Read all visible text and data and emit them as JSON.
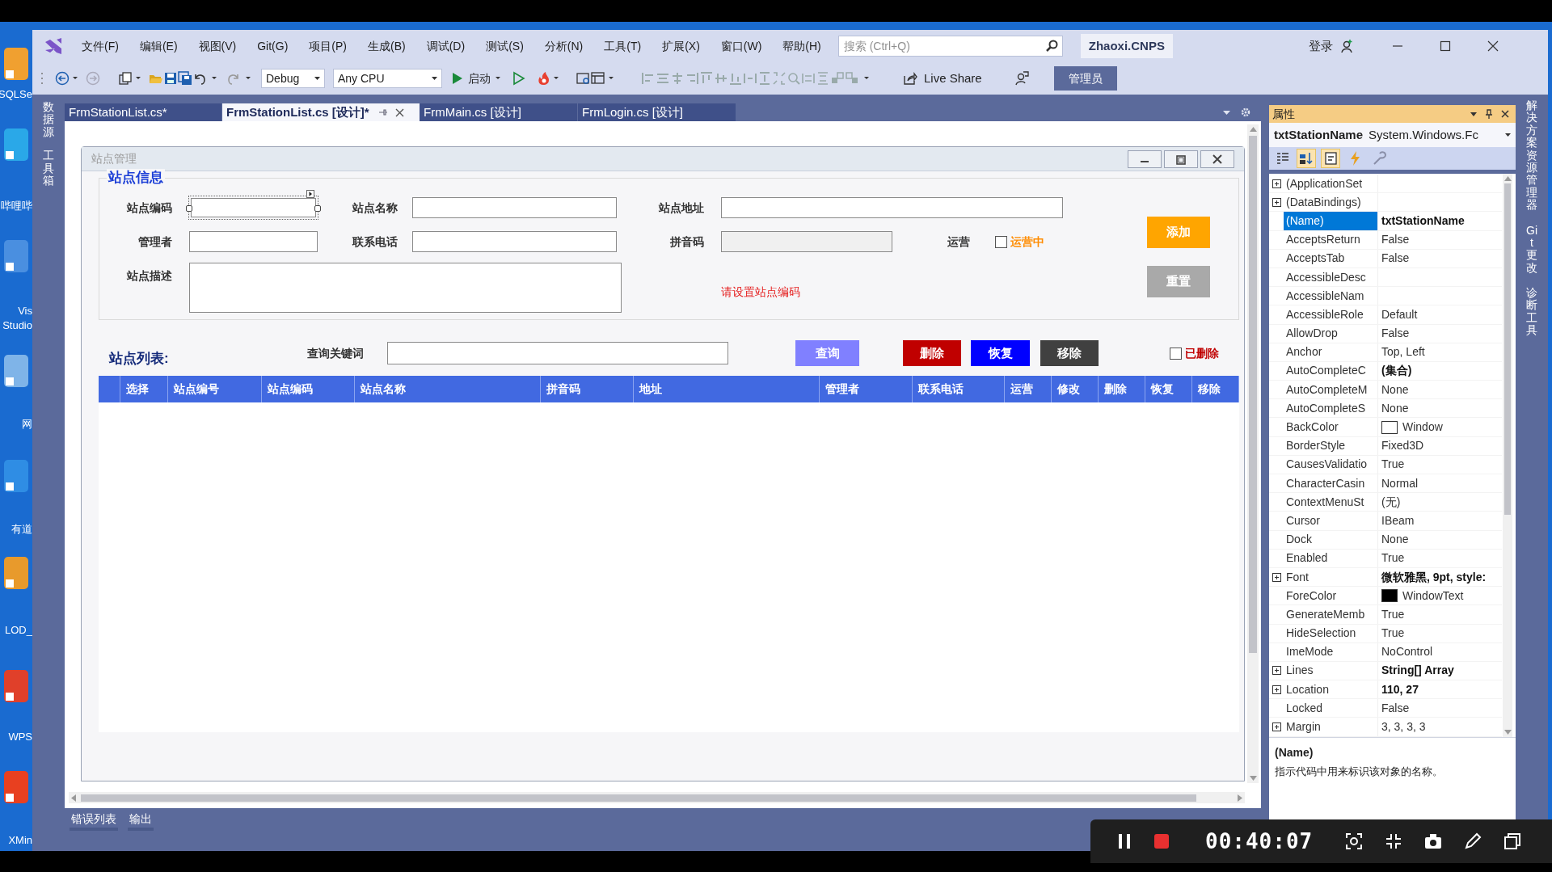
{
  "desktop_icons": [
    {
      "lines": [
        "SQLSe"
      ]
    },
    {
      "lines": [
        "哔哩哔"
      ]
    },
    {
      "lines": [
        "Vis",
        "Studio"
      ]
    },
    {
      "lines": [
        "网"
      ]
    },
    {
      "lines": [
        "有道"
      ]
    },
    {
      "lines": [
        "LOD_"
      ]
    },
    {
      "lines": [
        "WPS"
      ]
    },
    {
      "lines": [
        "XMin"
      ]
    }
  ],
  "menu": [
    "文件(F)",
    "编辑(E)",
    "视图(V)",
    "Git(G)",
    "项目(P)",
    "生成(B)",
    "调试(D)",
    "测试(S)",
    "分析(N)",
    "工具(T)",
    "扩展(X)",
    "窗口(W)",
    "帮助(H)"
  ],
  "search": {
    "placeholder": "搜索 (Ctrl+Q)"
  },
  "solution": "Zhaoxi.CNPS",
  "sign_in": "登录",
  "toolbar": {
    "configuration": "Debug",
    "platform": "Any CPU",
    "start": "启动"
  },
  "live_share": "Live Share",
  "role_badge": "管理员",
  "left_panels": [
    "数据源",
    "工具箱"
  ],
  "right_panels": [
    "解决方案资源管理器",
    "Git 更改",
    "诊断工具"
  ],
  "document_tabs": [
    {
      "label": "FrmStationList.cs*",
      "selected": false
    },
    {
      "label": "FrmStationList.cs [设计]*",
      "selected": true
    },
    {
      "label": "FrmMain.cs [设计]",
      "selected": false
    },
    {
      "label": "FrmLogin.cs [设计]",
      "selected": false
    }
  ],
  "form": {
    "title": "站点管理",
    "info_group": {
      "title": "站点信息",
      "fields": [
        {
          "label": "站点编码",
          "disabled": false,
          "selected": true
        },
        {
          "label": "站点名称",
          "disabled": false,
          "selected": false
        },
        {
          "label": "站点地址",
          "disabled": false,
          "selected": false
        },
        {
          "label": "管理者",
          "disabled": false,
          "selected": false
        },
        {
          "label": "联系电话",
          "disabled": false,
          "selected": false
        },
        {
          "label": "拼音码",
          "disabled": true,
          "selected": false
        },
        {
          "label": "站点描述",
          "disabled": false,
          "selected": false
        }
      ],
      "operation": {
        "label": "运营",
        "checkbox": {
          "label": "运营中",
          "checked": false
        }
      },
      "error_message": "请设置站点编码",
      "buttons": [
        {
          "label": "添加",
          "color": "#ffa500"
        },
        {
          "label": "重置",
          "color": "#a9a9a9"
        }
      ]
    },
    "list": {
      "title": "站点列表:",
      "search_label": "查询关键词",
      "actions": [
        {
          "label": "查询",
          "color": "#8080ff"
        },
        {
          "label": "删除",
          "color": "#c00000"
        },
        {
          "label": "恢复",
          "color": "#0000ff"
        },
        {
          "label": "移除",
          "color": "#404040"
        }
      ],
      "deleted_filter": {
        "label": "已删除",
        "checked": false
      },
      "columns": [
        "选择",
        "站点编号",
        "站点编码",
        "站点名称",
        "拼音码",
        "地址",
        "管理者",
        "联系电话",
        "运营",
        "修改",
        "删除",
        "恢复",
        "移除"
      ]
    }
  },
  "properties": {
    "title": "属性",
    "object_name": "txtStationName",
    "object_type": "System.Windows.Fc",
    "rows": [
      {
        "name": "(ApplicationSet",
        "expandable": true,
        "selected": false
      },
      {
        "name": "(DataBindings)",
        "expandable": true,
        "selected": false
      },
      {
        "name": "(Name)",
        "value": "txtStationName",
        "expandable": false,
        "modified": true,
        "selected": true
      },
      {
        "name": "AcceptsReturn",
        "value": "False",
        "expandable": false,
        "modified": false,
        "selected": false
      },
      {
        "name": "AcceptsTab",
        "value": "False",
        "expandable": false,
        "modified": false,
        "selected": false
      },
      {
        "name": "AccessibleDesc",
        "expandable": false,
        "selected": false
      },
      {
        "name": "AccessibleNam",
        "expandable": false,
        "selected": false
      },
      {
        "name": "AccessibleRole",
        "value": "Default",
        "expandable": false,
        "modified": false,
        "selected": false
      },
      {
        "name": "AllowDrop",
        "value": "False",
        "expandable": false,
        "modified": false,
        "selected": false
      },
      {
        "name": "Anchor",
        "value": "Top, Left",
        "expandable": false,
        "modified": false,
        "selected": false
      },
      {
        "name": "AutoCompleteC",
        "value": "(集合)",
        "expandable": false,
        "modified": true,
        "selected": false
      },
      {
        "name": "AutoCompleteM",
        "value": "None",
        "expandable": false,
        "modified": false,
        "selected": false
      },
      {
        "name": "AutoCompleteS",
        "value": "None",
        "expandable": false,
        "modified": false,
        "selected": false
      },
      {
        "name": "BackColor",
        "value": "Window",
        "color": "#ffffff",
        "expandable": false,
        "modified": false,
        "selected": false
      },
      {
        "name": "BorderStyle",
        "value": "Fixed3D",
        "expandable": false,
        "modified": false,
        "selected": false
      },
      {
        "name": "CausesValidatio",
        "value": "True",
        "expandable": false,
        "modified": false,
        "selected": false
      },
      {
        "name": "CharacterCasin",
        "value": "Normal",
        "expandable": false,
        "modified": false,
        "selected": false
      },
      {
        "name": "ContextMenuSt",
        "value": "(无)",
        "expandable": false,
        "modified": false,
        "selected": false
      },
      {
        "name": "Cursor",
        "value": "IBeam",
        "expandable": false,
        "modified": false,
        "selected": false
      },
      {
        "name": "Dock",
        "value": "None",
        "expandable": false,
        "modified": false,
        "selected": false
      },
      {
        "name": "Enabled",
        "value": "True",
        "expandable": false,
        "modified": false,
        "selected": false
      },
      {
        "name": "Font",
        "value": "微软雅黑, 9pt, style:",
        "expandable": true,
        "modified": true,
        "selected": false
      },
      {
        "name": "ForeColor",
        "value": "WindowText",
        "color": "#000000",
        "expandable": false,
        "modified": false,
        "selected": false
      },
      {
        "name": "GenerateMemb",
        "value": "True",
        "expandable": false,
        "modified": false,
        "selected": false
      },
      {
        "name": "HideSelection",
        "value": "True",
        "expandable": false,
        "modified": false,
        "selected": false
      },
      {
        "name": "ImeMode",
        "value": "NoControl",
        "expandable": false,
        "modified": false,
        "selected": false
      },
      {
        "name": "Lines",
        "value": "String[] Array",
        "expandable": true,
        "modified": true,
        "selected": false
      },
      {
        "name": "Location",
        "value": "110, 27",
        "expandable": true,
        "modified": true,
        "selected": false
      },
      {
        "name": "Locked",
        "value": "False",
        "expandable": false,
        "modified": false,
        "selected": false
      },
      {
        "name": "Margin",
        "value": "3, 3, 3, 3",
        "expandable": true,
        "modified": false,
        "selected": false
      }
    ],
    "description": {
      "title": "(Name)",
      "text": "指示代码中用来标识该对象的名称。"
    }
  },
  "bottom_tabs": [
    "错误列表",
    "输出"
  ],
  "recorder": {
    "time": "00:40:07"
  }
}
